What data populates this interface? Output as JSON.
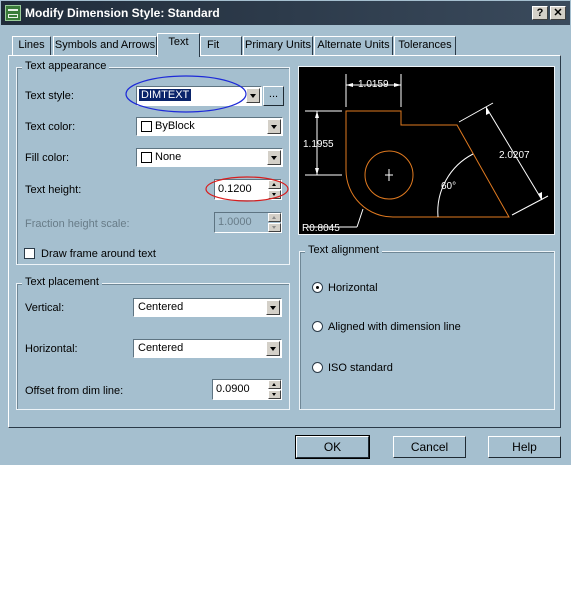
{
  "window": {
    "title": "Modify Dimension Style: Standard",
    "help_btn": "?",
    "close_btn": "✕"
  },
  "tabs": [
    "Lines",
    "Symbols and Arrows",
    "Text",
    "Fit",
    "Primary Units",
    "Alternate Units",
    "Tolerances"
  ],
  "text_appearance": {
    "legend": "Text appearance",
    "text_style_label": "Text style:",
    "text_style_value": "DIMTEXT",
    "ellipsis": "...",
    "text_color_label": "Text color:",
    "text_color_value": "ByBlock",
    "fill_color_label": "Fill color:",
    "fill_color_value": "None",
    "text_height_label": "Text height:",
    "text_height_value": "0.1200",
    "fraction_label": "Fraction height scale:",
    "fraction_value": "1.0000",
    "frame_label": "Draw frame around text"
  },
  "text_placement": {
    "legend": "Text placement",
    "vertical_label": "Vertical:",
    "vertical_value": "Centered",
    "horizontal_label": "Horizontal:",
    "horizontal_value": "Centered",
    "offset_label": "Offset from dim line:",
    "offset_value": "0.0900"
  },
  "text_alignment": {
    "legend": "Text alignment",
    "options": [
      "Horizontal",
      "Aligned with dimension line",
      "ISO standard"
    ],
    "selected": "Horizontal"
  },
  "preview": {
    "dim_top": "1.0159",
    "dim_left": "1.1955",
    "dim_right": "2.0207",
    "angle": "60°",
    "radius": "R0.8045"
  },
  "buttons": {
    "ok": "OK",
    "cancel": "Cancel",
    "help": "Help"
  },
  "colors": {
    "dialog_bg": "#a5bfcf",
    "highlight_blue": "#1d2ad8",
    "highlight_red": "#d81d1d",
    "preview_part": "#e07a20"
  }
}
